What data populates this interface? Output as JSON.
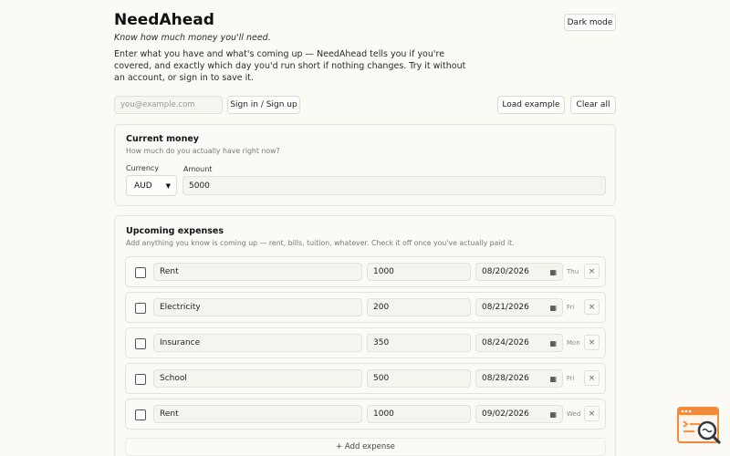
{
  "app": {
    "title": "NeedAhead",
    "tagline": "Know how much money you'll need.",
    "intro": "Enter what you have and what's coming up — NeedAhead tells you if you're covered, and exactly which day you'd run short if nothing changes. Try it without an account, or sign in to save it."
  },
  "toolbar": {
    "dark_mode": "Dark mode",
    "email_placeholder": "you@example.com",
    "sign_in": "Sign in / Sign up",
    "load_example": "Load example",
    "clear_all": "Clear all"
  },
  "current_money": {
    "title": "Current money",
    "subtitle": "How much do you actually have right now?",
    "currency_label": "Currency",
    "currency_value": "AUD",
    "amount_label": "Amount",
    "amount_value": "5000"
  },
  "expenses": {
    "title": "Upcoming expenses",
    "subtitle": "Add anything you know is coming up — rent, bills, tuition, whatever. Check it off once you've actually paid it.",
    "add_label": "+ Add expense",
    "items": [
      {
        "name": "Rent",
        "amount": "1000",
        "date": "08/20/2026",
        "weekday": "Thu",
        "remove": "×"
      },
      {
        "name": "Electricity",
        "amount": "200",
        "date": "08/21/2026",
        "weekday": "Fri",
        "remove": "×"
      },
      {
        "name": "Insurance",
        "amount": "350",
        "date": "08/24/2026",
        "weekday": "Mon",
        "remove": "×"
      },
      {
        "name": "School",
        "amount": "500",
        "date": "08/28/2026",
        "weekday": "Fri",
        "remove": "×"
      },
      {
        "name": "Rent",
        "amount": "1000",
        "date": "09/02/2026",
        "weekday": "Wed",
        "remove": "×"
      }
    ]
  },
  "icons": {
    "select_chevron": "chevron-down-icon",
    "calendar": "calendar-icon",
    "remove": "close-icon",
    "corner_logo": "browser-search-logo"
  },
  "colors": {
    "background": "#fbfaf5",
    "card_border": "#e6e5de",
    "logo_orange": "#f08a3c",
    "logo_dark": "#2f3a45"
  }
}
